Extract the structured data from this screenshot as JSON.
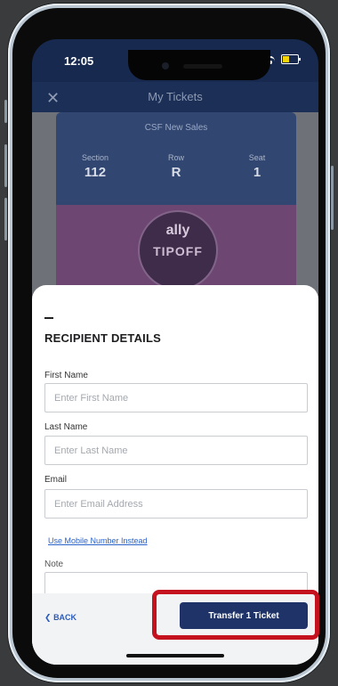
{
  "status_bar": {
    "time": "12:05"
  },
  "header": {
    "title": "My Tickets",
    "close_icon": "close-icon"
  },
  "ticket": {
    "event_name": "CSF New Sales",
    "seat_info": [
      {
        "label": "Section",
        "value": "112"
      },
      {
        "label": "Row",
        "value": "R"
      },
      {
        "label": "Seat",
        "value": "1"
      }
    ],
    "art": {
      "line1": "ally",
      "line2": "TIPOFF"
    }
  },
  "recipient_form": {
    "title": "RECIPIENT DETAILS",
    "first_name": {
      "label": "First Name",
      "placeholder": "Enter First Name",
      "value": ""
    },
    "last_name": {
      "label": "Last Name",
      "placeholder": "Enter Last Name",
      "value": ""
    },
    "email": {
      "label": "Email",
      "placeholder": "Enter Email Address",
      "value": ""
    },
    "mobile_link": "Use Mobile Number Instead",
    "note": {
      "label": "Note",
      "value": ""
    }
  },
  "footer": {
    "back_label": "BACK",
    "transfer_label": "Transfer 1 Ticket"
  },
  "colors": {
    "navy": "#1f3368",
    "highlight": "#c5121f",
    "link": "#2b63c8"
  }
}
